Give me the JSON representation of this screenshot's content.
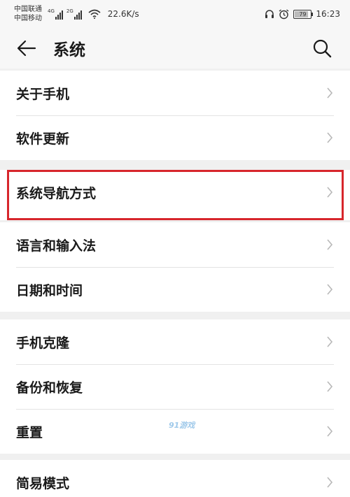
{
  "status_bar": {
    "carrier_1": "中国联通",
    "carrier_2": "中国移动",
    "signal_1_tag": "4G",
    "signal_2_tag": "2G",
    "speed": "22.6K/s",
    "battery": "79",
    "time": "16:23"
  },
  "header": {
    "title": "系统"
  },
  "groups": [
    {
      "items": [
        {
          "label": "关于手机"
        },
        {
          "label": "软件更新"
        }
      ]
    },
    {
      "items": [
        {
          "label": "系统导航方式"
        }
      ]
    },
    {
      "items": [
        {
          "label": "语言和输入法"
        },
        {
          "label": "日期和时间"
        }
      ]
    },
    {
      "items": [
        {
          "label": "手机克隆"
        },
        {
          "label": "备份和恢复"
        },
        {
          "label": "重置"
        }
      ]
    },
    {
      "items": [
        {
          "label": "简易模式"
        }
      ]
    }
  ],
  "watermark": "91游戏",
  "colors": {
    "highlight": "#d7262c",
    "background": "#f0f0f0"
  }
}
